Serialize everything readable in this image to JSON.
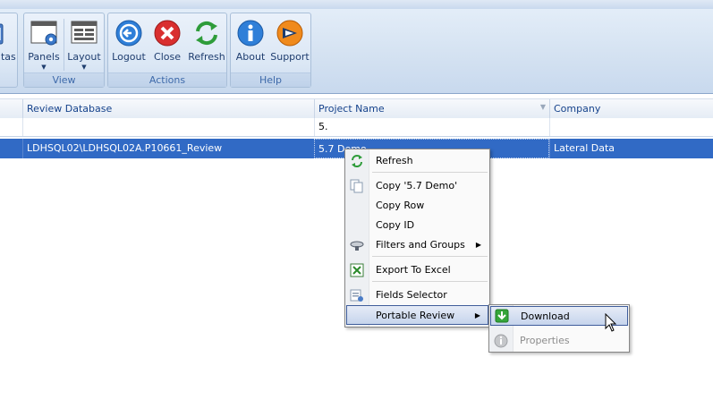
{
  "ribbon": {
    "partial_label": "atas",
    "groups": [
      {
        "label": "View",
        "buttons": [
          {
            "label": "Panels"
          },
          {
            "label": "Layout"
          }
        ]
      },
      {
        "label": "Actions",
        "buttons": [
          {
            "label": "Logout"
          },
          {
            "label": "Close"
          },
          {
            "label": "Refresh"
          }
        ]
      },
      {
        "label": "Help",
        "buttons": [
          {
            "label": "About"
          },
          {
            "label": "Support"
          }
        ]
      }
    ],
    "icons": {
      "panels": "panels-icon",
      "layout": "layout-icon",
      "logout": "logout-icon",
      "close": "close-icon",
      "refresh": "refresh-icon",
      "about": "info-icon",
      "support": "support-icon"
    }
  },
  "grid": {
    "columns": [
      "Review Database",
      "Project Name",
      "Company"
    ],
    "filter": {
      "project_name": "5."
    },
    "rows": [
      {
        "review_database": "LDHSQL02\\LDHSQL02A.P10661_Review",
        "project_name": "5.7 Demo",
        "company": "Lateral Data"
      }
    ]
  },
  "context_menu": {
    "items": [
      {
        "label": "Refresh",
        "icon": "refresh-icon"
      },
      {
        "label": "Copy '5.7 Demo'",
        "icon": "copy-icon"
      },
      {
        "label": "Copy Row"
      },
      {
        "label": "Copy ID"
      },
      {
        "label": "Filters and Groups",
        "icon": "filter-icon",
        "submenu": true
      },
      {
        "label": "Export To Excel",
        "icon": "excel-icon"
      },
      {
        "label": "Fields Selector",
        "icon": "fields-icon"
      },
      {
        "label": "Portable Review",
        "submenu": true,
        "highlighted": true
      }
    ]
  },
  "submenu": {
    "items": [
      {
        "label": "Download",
        "icon": "download-icon",
        "highlighted": true
      },
      {
        "label": "Properties",
        "icon": "info-icon",
        "disabled": true
      }
    ]
  },
  "colors": {
    "selection": "#316ac5",
    "ribbon_text": "#1e3d6e",
    "header_text": "#15428b"
  }
}
